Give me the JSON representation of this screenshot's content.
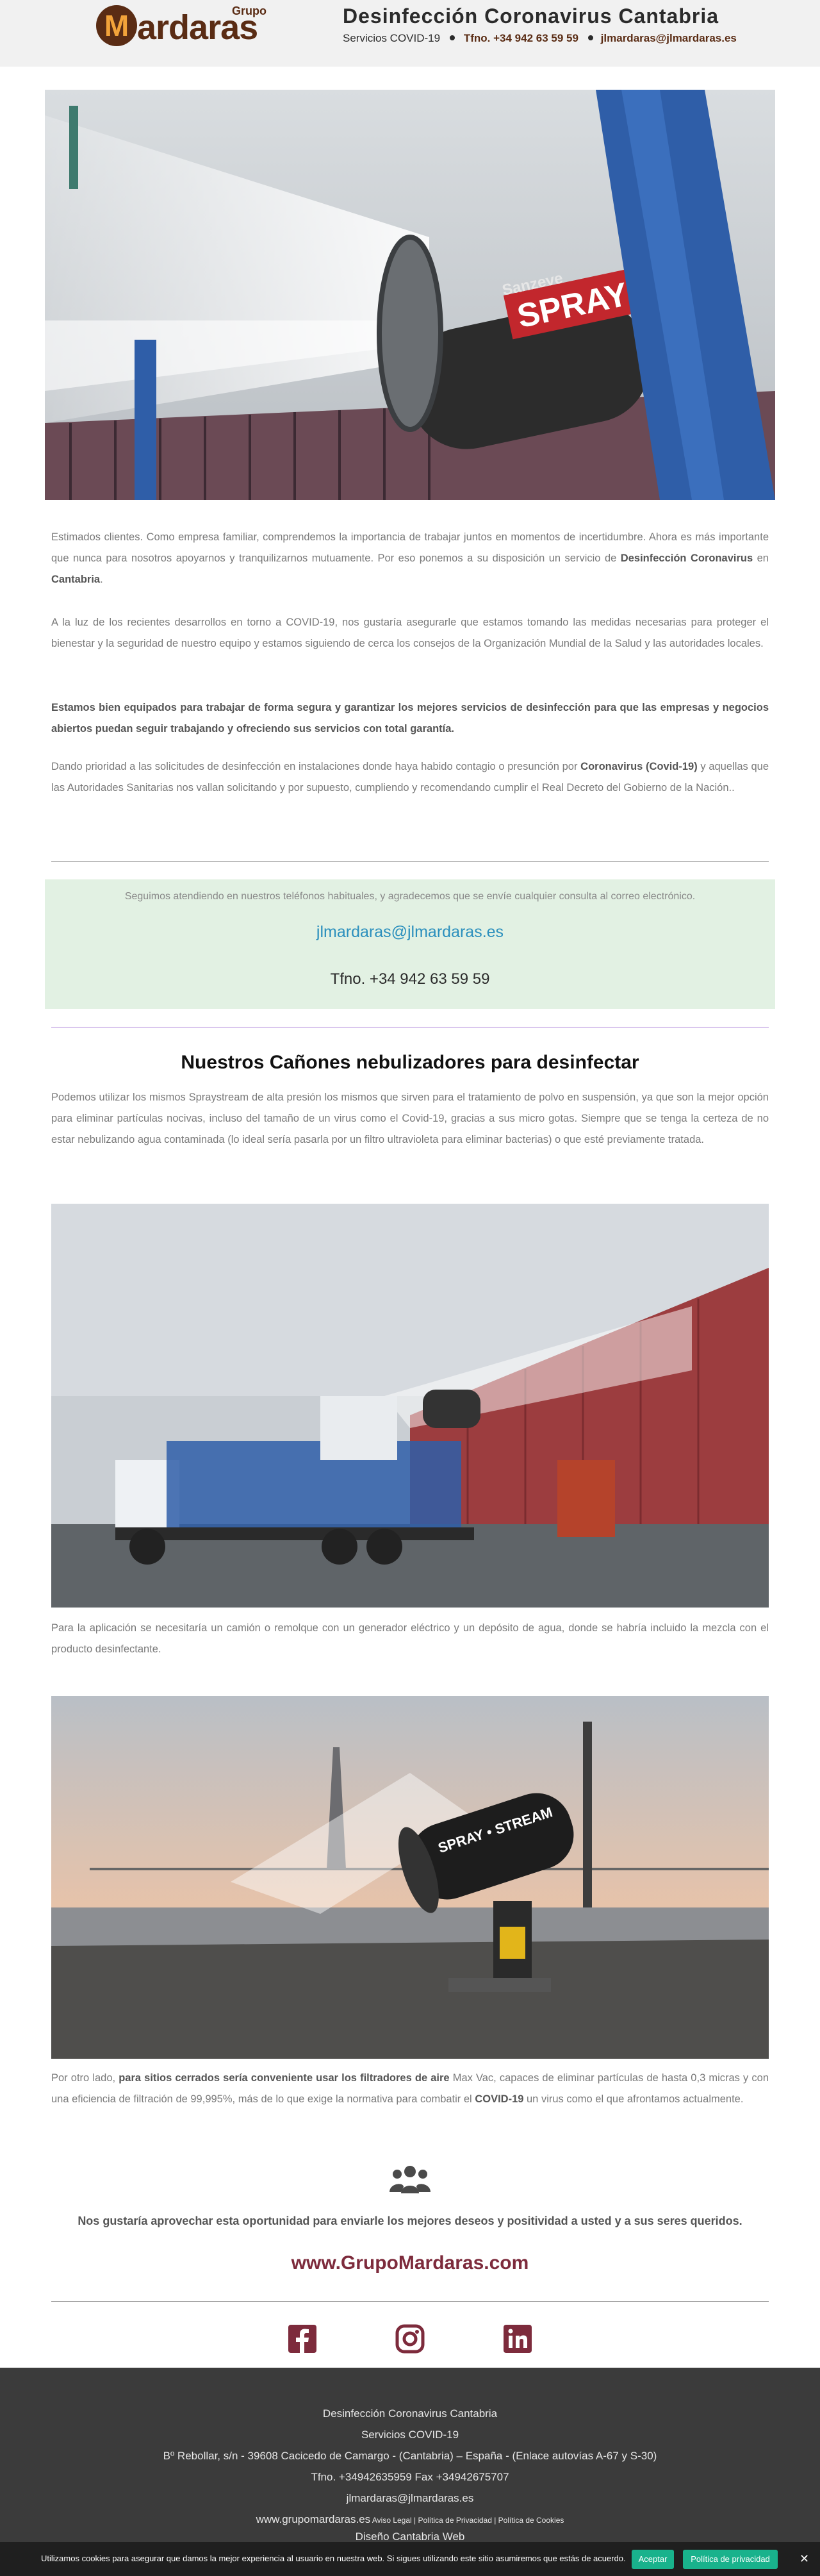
{
  "header": {
    "logo_grupo": "Grupo",
    "logo_letter": "M",
    "logo_name": "ardaras",
    "title": "Desinfección Coronavirus Cantabria",
    "services": "Servicios COVID-19",
    "phone": "Tfno. +34 942 63 59 59",
    "email": "jlmardaras@jlmardaras.es"
  },
  "hero": {
    "brand_top": "Sanzeve",
    "brand_main": "SPRAY",
    "brand_st": "ST"
  },
  "intro": {
    "p1_a": "Estimados clientes. Como empresa familiar, comprendemos la importancia de trabajar juntos en momentos de incertidumbre. Ahora es más importante que nunca para nosotros apoyarnos y tranquilizarnos mutuamente. Por eso ponemos a su disposición un servicio de ",
    "p1_b": "Desinfección Coronavirus",
    "p1_c": " en ",
    "p1_d": "Cantabria",
    "p1_e": ".",
    "p2": "A la luz de los recientes desarrollos en torno a COVID-19, nos gustaría asegurarle que estamos tomando las medidas necesarias para proteger el bienestar y la seguridad de nuestro equipo y estamos siguiendo de cerca los consejos de la Organización Mundial de la Salud y las autoridades locales.",
    "p3": "Estamos bien equipados para trabajar de forma segura y garantizar los mejores servicios de desinfección para que las empresas y negocios abiertos puedan seguir trabajando y ofreciendo sus servicios con total garantía.",
    "p4_a": "Dando prioridad a las solicitudes de desinfección en instalaciones donde haya habido contagio o presunción por ",
    "p4_b": "Coronavirus (Covid-19)",
    "p4_c": " y aquellas que las Autoridades Sanitarias nos vallan solicitando y por supuesto, cumpliendo y recomendando cumplir el Real Decreto del Gobierno de la Nación.."
  },
  "contact": {
    "note": "Seguimos atendiendo en nuestros teléfonos habituales, y agradecemos que se envíe cualquier consulta al correo electrónico.",
    "email": "jlmardaras@jlmardaras.es",
    "phone": "Tfno. +34 942 63 59 59"
  },
  "cannons": {
    "title": "Nuestros Cañones nebulizadores para desinfectar",
    "p1": "Podemos utilizar los mismos Spraystream de alta presión los mismos que sirven para el tratamiento de polvo en suspensión, ya que son la mejor opción para eliminar partículas nocivas, incluso del tamaño de un virus como el Covid-19, gracias a sus micro gotas. Siempre que se tenga la certeza de no estar nebulizando agua contaminada (lo ideal sería pasarla por un filtro ultravioleta para eliminar bacterias) o que esté previamente tratada.",
    "p2": "Para la aplicación se necesitaría un camión o remolque con un generador eléctrico y un depósito de agua, donde se habría incluido la mezcla con el producto desinfectante.",
    "p3_a": "Por otro lado, ",
    "p3_b": "para sitios cerrados sería conveniente usar los filtradores de aire",
    "p3_c": " Max Vac, capaces de eliminar partículas de hasta 0,3 micras y con una eficiencia de filtración de 99,995%, más de lo que exige la normativa para combatir el ",
    "p3_d": "COVID-19",
    "p3_e": " un virus como el que afrontamos actualmente.",
    "cannon_label": "SPRAY • STREAM"
  },
  "closing": {
    "wishes": "Nos gustaría aprovechar esta oportunidad para enviarle los mejores deseos y positividad a usted y a sus seres queridos.",
    "site": "www.GrupoMardaras.com"
  },
  "footer": {
    "l1": "Desinfección Coronavirus Cantabria",
    "l2": "Servicios COVID-19",
    "l3": "Bº Rebollar, s/n - 39608 Cacicedo de Camargo - (Cantabria) – España - (Enlace autovías A-67 y S-30)",
    "l4": "Tfno. +34942635959 Fax +34942675707",
    "l5": "jlmardaras@jlmardaras.es",
    "l6_site": "www.grupomardaras.es",
    "l6_links": " Aviso Legal | Política de Privacidad | Política de Cookies",
    "l7": "Diseño Cantabria Web"
  },
  "cookie": {
    "message": "Utilizamos cookies para asegurar que damos la mejor experiencia al usuario en nuestra web. Si sigues utilizando este sitio asumiremos que estás de acuerdo.",
    "accept": "Aceptar",
    "policy": "Política de privacidad",
    "close": "✕"
  },
  "colors": {
    "brand_brown": "#5a2c14",
    "accent_orange": "#f2a33a",
    "link_blue": "#2a8fbd",
    "site_red": "#7d2b3c",
    "cookie_green": "#19b28c",
    "contact_bg": "#e2f1e3"
  },
  "icons": [
    "people-icon",
    "facebook-icon",
    "instagram-icon",
    "linkedin-icon",
    "close-icon"
  ]
}
